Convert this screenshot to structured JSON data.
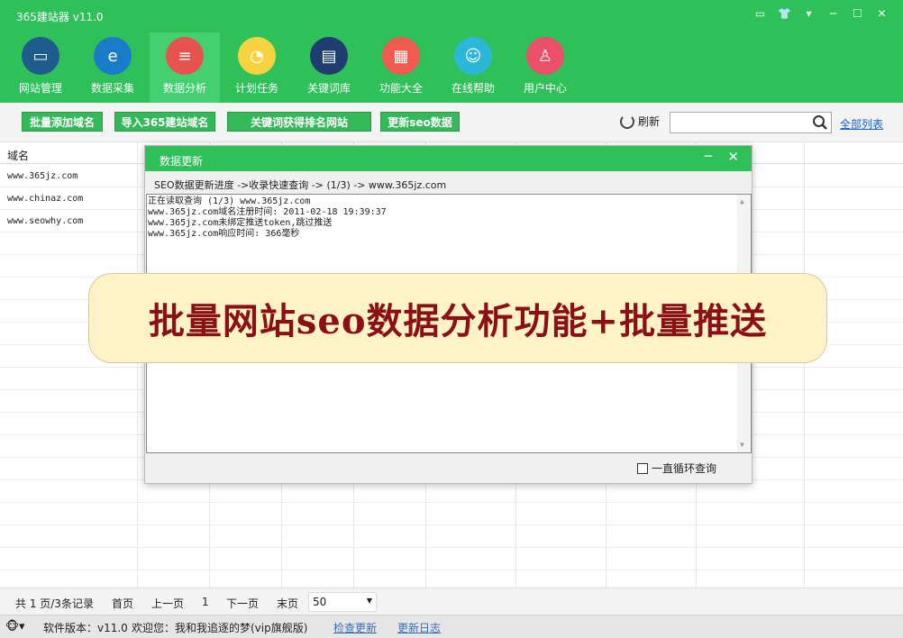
{
  "app": {
    "title": "365建站器 v11.0"
  },
  "window_controls": [
    "▭",
    "👕",
    "▾",
    "─",
    "☐",
    "✕"
  ],
  "toolbar": {
    "items": [
      {
        "label": "网站管理",
        "icon": "monitor-icon",
        "color": "#1e5c8e"
      },
      {
        "label": "数据采集",
        "icon": "ie-logo-icon",
        "color": "#1a7cc9"
      },
      {
        "label": "数据分析",
        "icon": "database-icon",
        "color": "#e7534f",
        "active": true
      },
      {
        "label": "计划任务",
        "icon": "clock-icon",
        "color": "#f6d441"
      },
      {
        "label": "关键词库",
        "icon": "book-icon",
        "color": "#1f3d70"
      },
      {
        "label": "功能大全",
        "icon": "grid-icon",
        "color": "#f15b4f"
      },
      {
        "label": "在线帮助",
        "icon": "support-icon",
        "color": "#2cb6d8"
      },
      {
        "label": "用户中心",
        "icon": "user-icon",
        "color": "#ec4f6a"
      }
    ]
  },
  "actions": {
    "batch_add": "批量添加域名",
    "import_365": "导入365建站域名",
    "keyword_rank": "关键词获得排名网站",
    "update_seo": "更新seo数据",
    "refresh": "刷新",
    "search_placeholder": "",
    "list_all": "全部列表"
  },
  "grid": {
    "header": "域名",
    "rows": [
      "www.365jz.com",
      "www.chinaz.com",
      "www.seowhy.com"
    ]
  },
  "dialog": {
    "title": "数据更新",
    "progress": "SEO数据更新进度 ->收录快速查询 -> (1/3) -> www.365jz.com",
    "log": [
      "正在读取查询 (1/3)  www.365jz.com",
      "www.365jz.com域名注册时间: 2011-02-18 19:39:37",
      "www.365jz.com未绑定推送token,跳过推送",
      "www.365jz.com响应时间: 366毫秒"
    ],
    "loop_label": "一直循环查询",
    "loop_checked": false
  },
  "banner": {
    "text": "批量网站seo数据分析功能+批量推送"
  },
  "pager": {
    "summary": "共 1 页/3条记录",
    "first": "首页",
    "prev": "上一页",
    "current": "1",
    "next": "下一页",
    "last": "末页",
    "page_size": "50"
  },
  "status": {
    "version": "软件版本：v11.0",
    "welcome": "欢迎您：我和我追逐的梦(vip旗舰版)",
    "check_update": "检查更新",
    "update_log": "更新日志"
  },
  "colors": {
    "brand_green": "#2fc05a",
    "banner_text": "#8a1016",
    "banner_bg": "#fdf3c6"
  }
}
